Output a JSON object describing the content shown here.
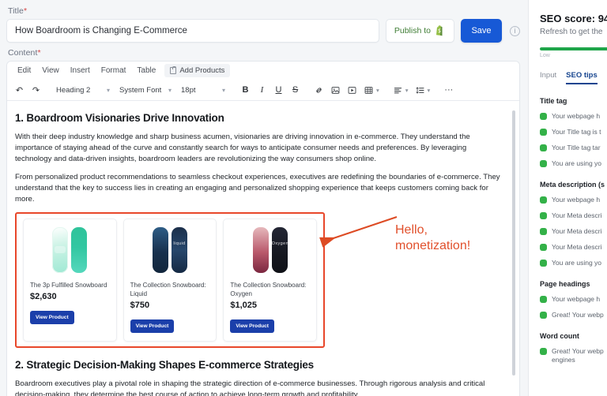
{
  "form": {
    "title_label": "Title",
    "title_value": "How Boardroom is Changing E-Commerce",
    "content_label": "Content",
    "required_marker": "*"
  },
  "header": {
    "publish_label": "Publish to",
    "publish_icon": "shopify-bag-icon",
    "save_label": "Save",
    "info_icon": "ⓘ"
  },
  "menubar": {
    "items": [
      {
        "label": "Edit"
      },
      {
        "label": "View"
      },
      {
        "label": "Insert"
      },
      {
        "label": "Format"
      },
      {
        "label": "Table"
      }
    ],
    "add_products_label": "Add Products"
  },
  "toolbar": {
    "undo_icon": "↶",
    "redo_icon": "↷",
    "block_format": "Heading 2",
    "font_family": "System Font",
    "font_size": "18pt",
    "bold": "B",
    "italic": "I",
    "underline": "U",
    "strike": "S",
    "link_icon": "🔗",
    "image_icon": "❑",
    "media_icon": "▶",
    "table_icon": "▦",
    "align_icon": "≡",
    "lineheight_icon": "↕",
    "more_icon": "···",
    "chevron": "⌄"
  },
  "document": {
    "heading_1": "1. Boardroom Visionaries Drive Innovation",
    "paragraph_1": "With their deep industry knowledge and sharp business acumen, visionaries are driving innovation in e-commerce. They understand the importance of staying ahead of the curve and constantly search for ways to anticipate consumer needs and preferences. By leveraging technology and data-driven insights, boardroom leaders are revolutionizing the way consumers shop online.",
    "paragraph_2": "From personalized product recommendations to seamless checkout experiences, executives are redefining the boundaries of e-commerce. They understand that the key to success lies in creating an engaging and personalized shopping experience that keeps customers coming back for more.",
    "heading_2": "2. Strategic Decision-Making Shapes E-commerce Strategies",
    "paragraph_3": "Boardroom executives play a pivotal role in shaping the strategic direction of e-commerce businesses. Through rigorous analysis and critical decision-making, they determine the best course of action to achieve long-term growth and profitability."
  },
  "products": {
    "border_color": "#e8472a",
    "button_label": "View Product",
    "items": [
      {
        "name": "The 3p Fulfilled Snowboard",
        "price": "$2,630",
        "wordmark": ""
      },
      {
        "name": "The Collection Snowboard: Liquid",
        "price": "$750",
        "wordmark": "liquid"
      },
      {
        "name": "The Collection Snowboard: Oxygen",
        "price": "$1,025",
        "wordmark": "Oxygen"
      }
    ]
  },
  "annotation": {
    "line_1": "Hello,",
    "line_2": "monetization!",
    "color": "#e1502c"
  },
  "seo": {
    "score_label": "SEO score: 94",
    "refresh_text": "Refresh to get the",
    "bar_percent": 94,
    "bar_color": "#1fa54a",
    "bar_low_label": "Low",
    "tabs": [
      {
        "label": "Input",
        "active": false
      },
      {
        "label": "SEO tips",
        "active": true
      }
    ],
    "sections": [
      {
        "heading": "Title tag",
        "items": [
          "Your webpage h",
          "Your Title tag is t",
          "Your Title tag tar",
          "You are using yo"
        ]
      },
      {
        "heading": "Meta description (s",
        "items": [
          "Your webpage h",
          "Your Meta descri",
          "Your Meta descri",
          "Your Meta descri",
          "You are using yo"
        ]
      },
      {
        "heading": "Page headings",
        "items": [
          "Your webpage h",
          "Great! Your webp"
        ]
      },
      {
        "heading": "Word count",
        "items": [
          "Great! Your webp engines"
        ]
      }
    ]
  }
}
